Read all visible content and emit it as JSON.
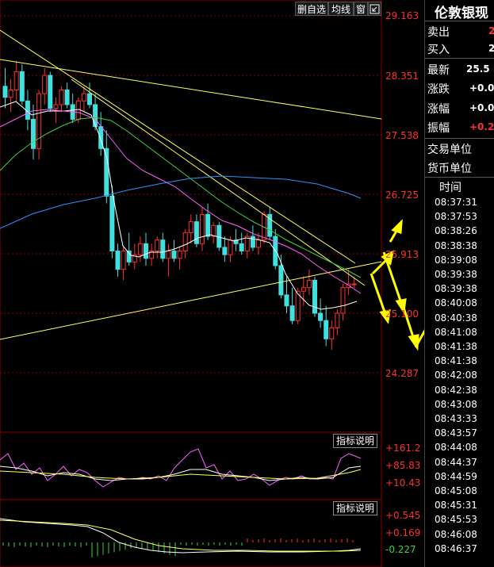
{
  "toolbar": {
    "delete_watch": "删自选",
    "ma_lines": "均线",
    "window": "窗",
    "expand_icon": "expand-arrow-icon"
  },
  "price_axis": [
    "29.163",
    "28.351",
    "27.538",
    "26.725",
    "25.913",
    "25.100",
    "24.287"
  ],
  "indicator1": {
    "button": "指标说明",
    "labels": [
      "+161.2",
      "+85.83",
      "+10.43"
    ]
  },
  "indicator2": {
    "button": "指标说明",
    "labels": [
      "+0.545",
      "+0.169",
      "-0.227"
    ]
  },
  "quote_panel": {
    "title": "伦敦银现",
    "sell_label": "卖出",
    "sell_value": "2",
    "buy_label": "买入",
    "buy_value": "2",
    "latest_label": "最新",
    "latest_value": "25.5",
    "change_label": "涨跌",
    "change_value": "+0.0",
    "change_pct_label": "涨幅",
    "change_pct_value": "+0.0",
    "amplitude_label": "振幅",
    "amplitude_value": "+0.2",
    "trade_unit_label": "交易单位",
    "currency_unit_label": "货币单位",
    "time_header": "时间",
    "times": [
      "08:37:31",
      "08:37:53",
      "08:38:26",
      "08:38:38",
      "08:39:08",
      "08:39:38",
      "08:39:38",
      "08:40:08",
      "08:40:38",
      "08:41:08",
      "08:41:38",
      "08:41:38",
      "08:42:08",
      "08:42:38",
      "08:43:08",
      "08:43:33",
      "08:43:57",
      "08:44:08",
      "08:44:37",
      "08:44:59",
      "08:45:08",
      "08:45:31",
      "08:45:53",
      "08:46:08",
      "08:46:37"
    ]
  },
  "colors": {
    "up_candle": "#ff3030",
    "down_candle": "#40e0e0",
    "trendline": "#ffff60",
    "ma_fast": "#ffffff",
    "ma_mid": "#ff60ff",
    "ma_slow": "#40d040",
    "ma_long": "#3090ff",
    "annotation_arrows": "#ffff00"
  },
  "chart_data": {
    "type": "candlestick",
    "ylim": [
      24.287,
      29.163
    ],
    "candles": [
      [
        28.2,
        28.45,
        27.9,
        28.05
      ],
      [
        28.05,
        28.3,
        27.85,
        28.15
      ],
      [
        28.15,
        28.55,
        28.0,
        28.4
      ],
      [
        28.4,
        28.5,
        27.95,
        28.0
      ],
      [
        28.0,
        28.15,
        27.6,
        27.75
      ],
      [
        27.75,
        27.95,
        27.2,
        27.35
      ],
      [
        27.35,
        28.15,
        27.2,
        28.1
      ],
      [
        28.1,
        28.45,
        27.95,
        28.35
      ],
      [
        28.35,
        28.4,
        27.85,
        27.9
      ],
      [
        27.9,
        28.05,
        27.7,
        27.95
      ],
      [
        27.95,
        28.2,
        27.85,
        28.15
      ],
      [
        28.15,
        28.25,
        27.9,
        27.95
      ],
      [
        27.95,
        28.1,
        27.7,
        27.75
      ],
      [
        27.75,
        28.05,
        27.7,
        28.0
      ],
      [
        28.0,
        28.2,
        27.85,
        28.1
      ],
      [
        28.1,
        28.25,
        27.9,
        27.95
      ],
      [
        27.95,
        28.1,
        27.6,
        27.65
      ],
      [
        27.65,
        27.85,
        27.25,
        27.35
      ],
      [
        27.35,
        27.6,
        26.6,
        26.7
      ],
      [
        26.7,
        26.85,
        25.85,
        25.95
      ],
      [
        25.95,
        26.05,
        25.6,
        25.7
      ],
      [
        25.7,
        26.0,
        25.55,
        25.95
      ],
      [
        25.95,
        26.2,
        25.75,
        25.8
      ],
      [
        25.8,
        26.05,
        25.7,
        25.9
      ],
      [
        25.9,
        26.15,
        25.8,
        26.05
      ],
      [
        26.05,
        26.2,
        25.75,
        25.85
      ],
      [
        25.85,
        26.05,
        25.75,
        25.95
      ],
      [
        25.95,
        26.15,
        25.85,
        26.1
      ],
      [
        26.1,
        26.2,
        25.8,
        25.85
      ],
      [
        25.85,
        26.05,
        25.6,
        25.95
      ],
      [
        25.95,
        26.1,
        25.8,
        25.85
      ],
      [
        25.85,
        26.0,
        25.7,
        25.95
      ],
      [
        25.95,
        26.25,
        25.85,
        26.2
      ],
      [
        26.2,
        26.45,
        26.05,
        26.35
      ],
      [
        26.35,
        26.45,
        26.0,
        26.05
      ],
      [
        26.05,
        26.55,
        25.95,
        26.45
      ],
      [
        26.45,
        26.6,
        26.1,
        26.15
      ],
      [
        26.15,
        26.35,
        26.05,
        26.3
      ],
      [
        26.3,
        26.35,
        25.95,
        26.0
      ],
      [
        26.0,
        26.15,
        25.8,
        25.9
      ],
      [
        25.9,
        26.15,
        25.8,
        26.1
      ],
      [
        26.1,
        26.25,
        25.95,
        26.05
      ],
      [
        26.05,
        26.2,
        25.9,
        25.95
      ],
      [
        25.95,
        26.2,
        25.85,
        26.15
      ],
      [
        26.15,
        26.3,
        25.95,
        26.0
      ],
      [
        26.0,
        26.2,
        25.9,
        26.1
      ],
      [
        26.1,
        26.5,
        26.05,
        26.45
      ],
      [
        26.45,
        26.55,
        26.1,
        26.15
      ],
      [
        26.15,
        26.25,
        25.7,
        25.75
      ],
      [
        25.75,
        25.9,
        25.3,
        25.35
      ],
      [
        25.35,
        25.6,
        25.1,
        25.2
      ],
      [
        25.2,
        25.45,
        24.95,
        25.0
      ],
      [
        25.0,
        25.45,
        24.95,
        25.4
      ],
      [
        25.4,
        25.6,
        25.2,
        25.45
      ],
      [
        25.45,
        25.7,
        25.35,
        25.55
      ],
      [
        25.55,
        25.6,
        25.05,
        25.1
      ],
      [
        25.1,
        25.3,
        24.9,
        25.0
      ],
      [
        25.0,
        25.2,
        24.65,
        24.75
      ],
      [
        24.75,
        25.0,
        24.6,
        24.9
      ],
      [
        24.9,
        25.15,
        24.8,
        25.1
      ],
      [
        25.1,
        25.5,
        25.0,
        25.45
      ],
      [
        25.45,
        25.7,
        25.35,
        25.5
      ],
      [
        25.5,
        25.6,
        25.45,
        25.5
      ]
    ]
  }
}
